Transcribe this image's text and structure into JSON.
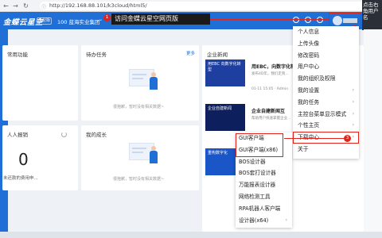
{
  "browser": {
    "url": "http://192.168.88.101/k3cloud/html5/"
  },
  "header": {
    "logo": "金蝶云星空",
    "logo_tag": "企业版",
    "org": "100 蓝海实业集团",
    "org_caret": "⌄"
  },
  "annotation": {
    "callout": "访问金蝶云星空网页版",
    "badge1": "1",
    "badge2": "2",
    "badge3": "3",
    "right_tip": "点击右角用户名"
  },
  "cards": {
    "common": {
      "title": "常用功能"
    },
    "todo": {
      "title": "待办任务",
      "more": "更多",
      "empty": "很抱歉，暂时没有相关数据~"
    },
    "news": {
      "title": "企业新闻",
      "items": [
        {
          "thumb": "用EBC 向数字化转型",
          "title": "用EBC，向数字化转型",
          "desc": "发布4D年，我们走到...",
          "meta": "01-11 15:05 · Admin"
        },
        {
          "thumb": "企业自建新闻",
          "title": "企业自建新闻互",
          "desc": "帮助用户快速掌握企业...",
          "meta": ""
        },
        {
          "thumb": "重构数字化",
          "title": "",
          "desc": "",
          "meta": ""
        }
      ]
    },
    "reimburse": {
      "title": "人人报销",
      "value": "0",
      "sub": "未还款的费用申..."
    },
    "growth": {
      "title": "我的成长",
      "empty": "很抱歉，暂时没有相关数据~"
    }
  },
  "menu": {
    "items": [
      {
        "label": "个人信息",
        "arrow": ""
      },
      {
        "label": "上传头像",
        "arrow": ""
      },
      {
        "label": "修改密码",
        "arrow": ""
      },
      {
        "label": "用户中心",
        "arrow": ""
      },
      {
        "label": "我的组织及权限",
        "arrow": ""
      },
      {
        "label": "我的设置",
        "arrow": "›"
      },
      {
        "label": "我的任务",
        "arrow": "›"
      },
      {
        "label": "主控台菜单显示模式",
        "arrow": "›"
      },
      {
        "label": "个性主页",
        "arrow": "›"
      },
      {
        "label": "下载中心",
        "arrow": "›"
      },
      {
        "label": "关于",
        "arrow": ""
      }
    ]
  },
  "submenu": {
    "items": [
      {
        "label": "GUI客户端",
        "arrow": ""
      },
      {
        "label": "GUI客户端(x86)",
        "arrow": ""
      },
      {
        "label": "BOS设计器",
        "arrow": ""
      },
      {
        "label": "BOS套打设计器",
        "arrow": ""
      },
      {
        "label": "万能报表设计器",
        "arrow": ""
      },
      {
        "label": "网络检测工具",
        "arrow": ""
      },
      {
        "label": "RPA机器人客户端",
        "arrow": ""
      },
      {
        "label": "设计器(x64)",
        "arrow": "›"
      }
    ]
  },
  "colors": {
    "brand": "#1f6fd6",
    "annotation": "#e2231a"
  }
}
